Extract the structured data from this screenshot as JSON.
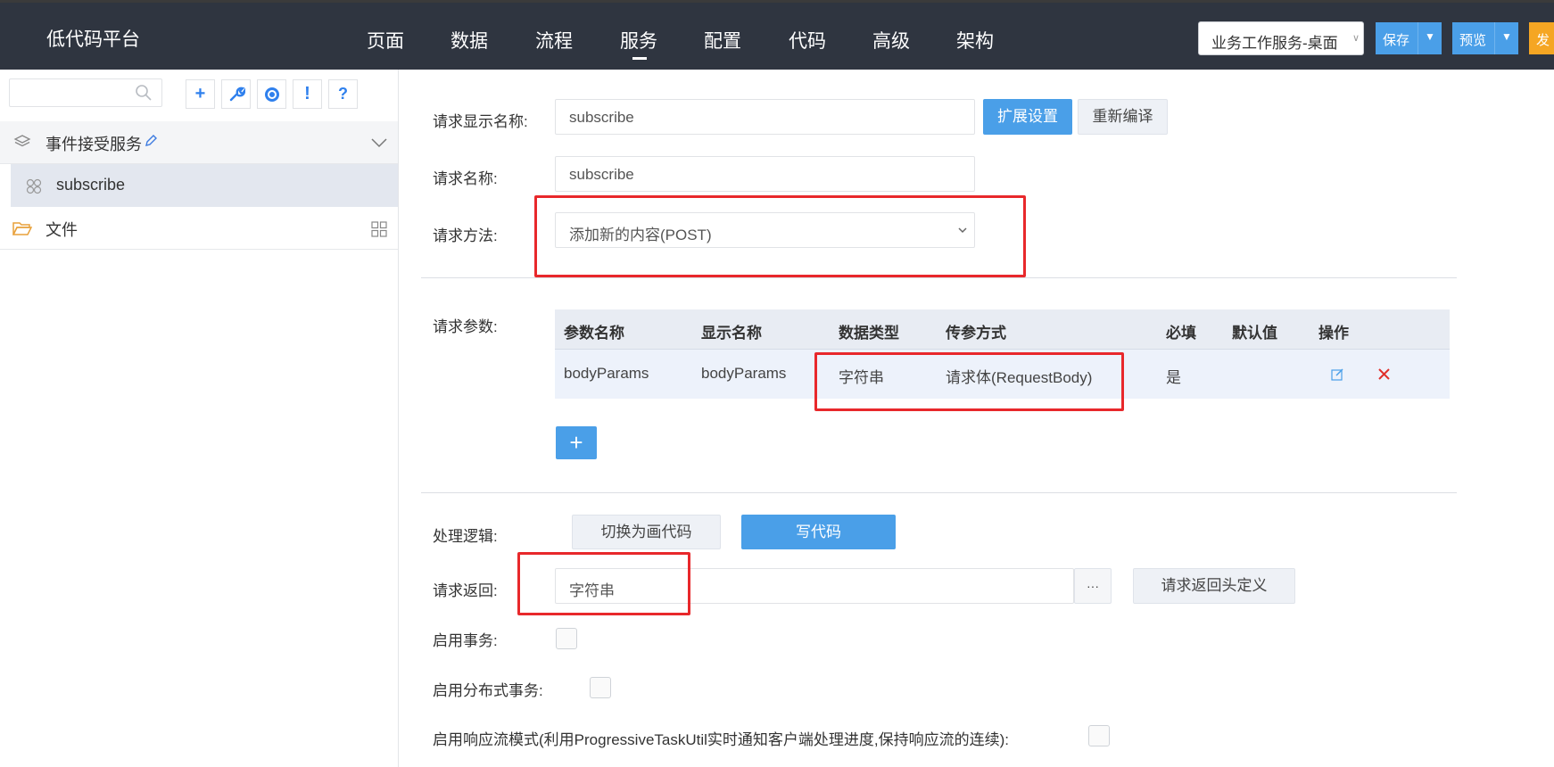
{
  "brand": "低代码平台",
  "nav": [
    "页面",
    "数据",
    "流程",
    "服务",
    "配置",
    "代码",
    "高级",
    "架构"
  ],
  "active_nav": "服务",
  "app_selector": "业务工作服务-桌面",
  "toolbar": {
    "save": "保存",
    "preview": "预览",
    "publish": "发"
  },
  "sidebar": {
    "search_placeholder": "",
    "tools": [
      "add-icon",
      "wrench-icon",
      "target-icon",
      "exclamation-icon",
      "question-icon"
    ],
    "group": "事件接受服务",
    "child": "subscribe",
    "files": "文件"
  },
  "form": {
    "display_name_label": "请求显示名称:",
    "display_name_value": "subscribe",
    "ext_settings": "扩展设置",
    "recompile": "重新编译",
    "name_label": "请求名称:",
    "name_value": "subscribe",
    "method_label": "请求方法:",
    "method_value": "添加新的内容(POST)",
    "params_label": "请求参数:",
    "params_headers": [
      "参数名称",
      "显示名称",
      "数据类型",
      "传参方式",
      "必填",
      "默认值",
      "操作"
    ],
    "params_rows": [
      [
        "bodyParams",
        "bodyParams",
        "字符串",
        "请求体(RequestBody)",
        "是",
        ""
      ]
    ],
    "add_param": "+",
    "logic_label": "处理逻辑:",
    "switch_draw": "切换为画代码",
    "write_code": "写代码",
    "return_label": "请求返回:",
    "return_value": "字符串",
    "ellipsis": "···",
    "return_header_def": "请求返回头定义",
    "transaction_label": "启用事务:",
    "distributed_label": "启用分布式事务:",
    "stream_label": "启用响应流模式(利用ProgressiveTaskUtil实时通知客户端处理进度,保持响应流的连续):"
  },
  "colors": {
    "topbar": "#2f3540",
    "accent": "#4a9fe8",
    "highlight": "#e8282b",
    "orange": "#f5a623"
  }
}
